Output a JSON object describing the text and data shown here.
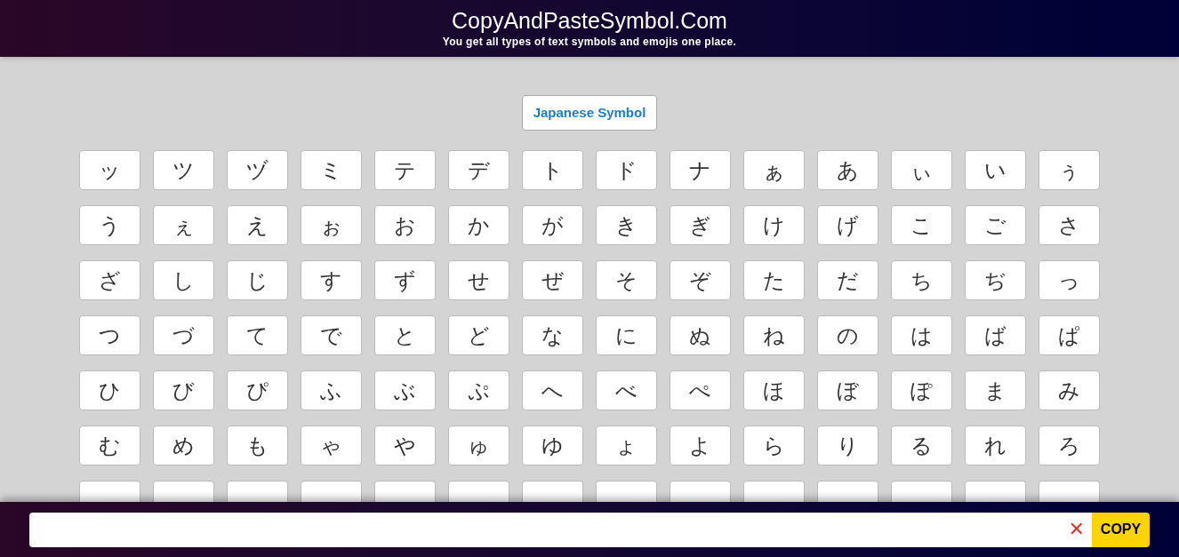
{
  "header": {
    "title": "CopyAndPasteSymbol.Com",
    "subtitle": "You get all types of text symbols and emojis one place."
  },
  "category_button": "Japanese Symbol",
  "symbols": [
    "ッ",
    "ツ",
    "ヅ",
    "ミ",
    "テ",
    "デ",
    "ト",
    "ド",
    "ナ",
    "ぁ",
    "あ",
    "ぃ",
    "い",
    "ぅ",
    "う",
    "ぇ",
    "え",
    "ぉ",
    "お",
    "か",
    "が",
    "き",
    "ぎ",
    "け",
    "げ",
    "こ",
    "ご",
    "さ",
    "ざ",
    "し",
    "じ",
    "す",
    "ず",
    "せ",
    "ぜ",
    "そ",
    "ぞ",
    "た",
    "だ",
    "ち",
    "ぢ",
    "っ",
    "つ",
    "づ",
    "て",
    "で",
    "と",
    "ど",
    "な",
    "に",
    "ぬ",
    "ね",
    "の",
    "は",
    "ば",
    "ぱ",
    "ひ",
    "び",
    "ぴ",
    "ふ",
    "ぶ",
    "ぷ",
    "へ",
    "べ",
    "ぺ",
    "ほ",
    "ぼ",
    "ぽ",
    "ま",
    "み",
    "む",
    "め",
    "も",
    "ゃ",
    "や",
    "ゅ",
    "ゆ",
    "ょ",
    "よ",
    "ら",
    "り",
    "る",
    "れ",
    "ろ"
  ],
  "copy_bar": {
    "clear": "✕",
    "copy_button": "COPY"
  }
}
